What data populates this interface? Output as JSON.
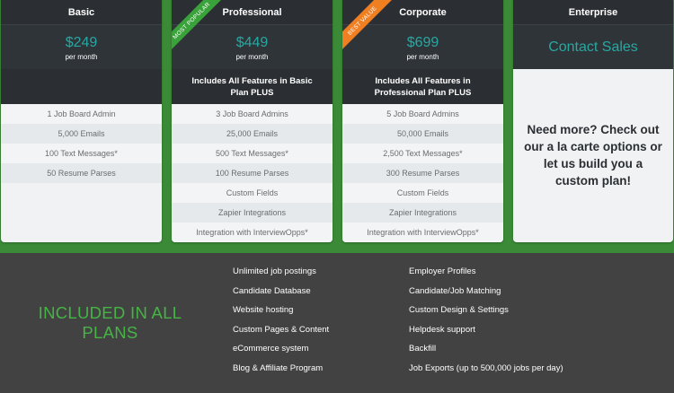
{
  "plans": [
    {
      "name": "Basic",
      "price": "$249",
      "period": "per month",
      "subtitle": "",
      "ribbon": "",
      "features": [
        "1 Job Board Admin",
        "5,000 Emails",
        "100 Text Messages*",
        "50 Resume Parses"
      ]
    },
    {
      "name": "Professional",
      "price": "$449",
      "period": "per month",
      "subtitle": "Includes All Features in Basic Plan PLUS",
      "ribbon": "MOST POPULAR",
      "features": [
        "3 Job Board Admins",
        "25,000 Emails",
        "500 Text Messages*",
        "100 Resume Parses",
        "Custom Fields",
        "Zapier Integrations",
        "Integration with InterviewOpps*"
      ]
    },
    {
      "name": "Corporate",
      "price": "$699",
      "period": "per month",
      "subtitle": "Includes All Features in Professional Plan PLUS",
      "ribbon": "BEST VALUE",
      "features": [
        "5 Job Board Admins",
        "50,000 Emails",
        "2,500 Text Messages*",
        "300 Resume Parses",
        "Custom Fields",
        "Zapier Integrations",
        "Integration with InterviewOpps*"
      ]
    },
    {
      "name": "Enterprise",
      "contact": "Contact Sales",
      "body": "Need more? Check out our a la carte options or let us build you a custom plan!"
    }
  ],
  "included": {
    "title": "INCLUDED IN ALL PLANS",
    "col1": [
      "Unlimited job postings",
      "Candidate Database",
      "Website hosting",
      "Custom Pages & Content",
      "eCommerce system",
      "Blog & Affiliate Program"
    ],
    "col2": [
      "Employer Profiles",
      "Candidate/Job Matching",
      "Custom Design & Settings",
      "Helpdesk support",
      "Backfill",
      "Job Exports (up to 500,000 jobs per day)"
    ]
  },
  "colors": {
    "background_green": "#3a8a37",
    "card_dark": "#2b2f33",
    "price_teal": "#27a8a1",
    "ribbon_green": "#3aa23a",
    "ribbon_orange": "#f07f22",
    "included_bg": "#424242",
    "included_title": "#45b445"
  }
}
